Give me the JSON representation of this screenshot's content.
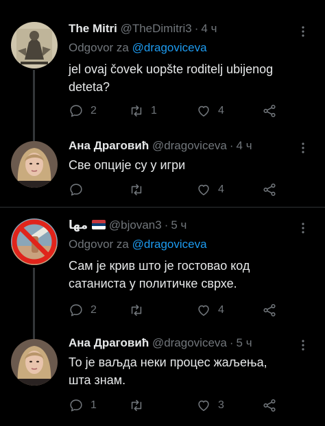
{
  "tweets": [
    {
      "name": "The Mitri",
      "handle": "@TheDimitri3",
      "time": "4 ч",
      "reply_prefix": "Odgovor za",
      "reply_mention": "@dragoviceva",
      "text": [
        "jel ovaj čovek uopšte roditelj ubijenog",
        "deteta?"
      ],
      "replies": "2",
      "retweets": "1",
      "likes": "4"
    },
    {
      "name": "Ана Драговић",
      "handle": "@dragoviceva",
      "time": "4 ч",
      "text": [
        "Све опције су у игри"
      ],
      "replies": "",
      "retweets": "",
      "likes": "4"
    },
    {
      "name": "مها",
      "handle": "@bjovan3",
      "time": "5 ч",
      "reply_prefix": "Odgovor za",
      "reply_mention": "@dragoviceva",
      "text": [
        "Сам је крив што је гостовао код",
        "сатаниста у политичке сврхе."
      ],
      "replies": "2",
      "retweets": "",
      "likes": "4"
    },
    {
      "name": "Ана Драговић",
      "handle": "@dragoviceva",
      "time": "5 ч",
      "text": [
        "То је ваљда неки процес жаљења,",
        "шта знам."
      ],
      "replies": "1",
      "retweets": "",
      "likes": "3"
    }
  ],
  "icons": {
    "reply": "reply-icon",
    "retweet": "retweet-icon",
    "like": "heart-icon",
    "share": "share-icon",
    "more": "more-options-icon",
    "flag": "serbia-flag-icon"
  },
  "colors": {
    "background": "#000000",
    "text": "#e7e9ea",
    "muted": "#71767b",
    "link": "#1d9bf0",
    "divider": "#2f3336"
  }
}
